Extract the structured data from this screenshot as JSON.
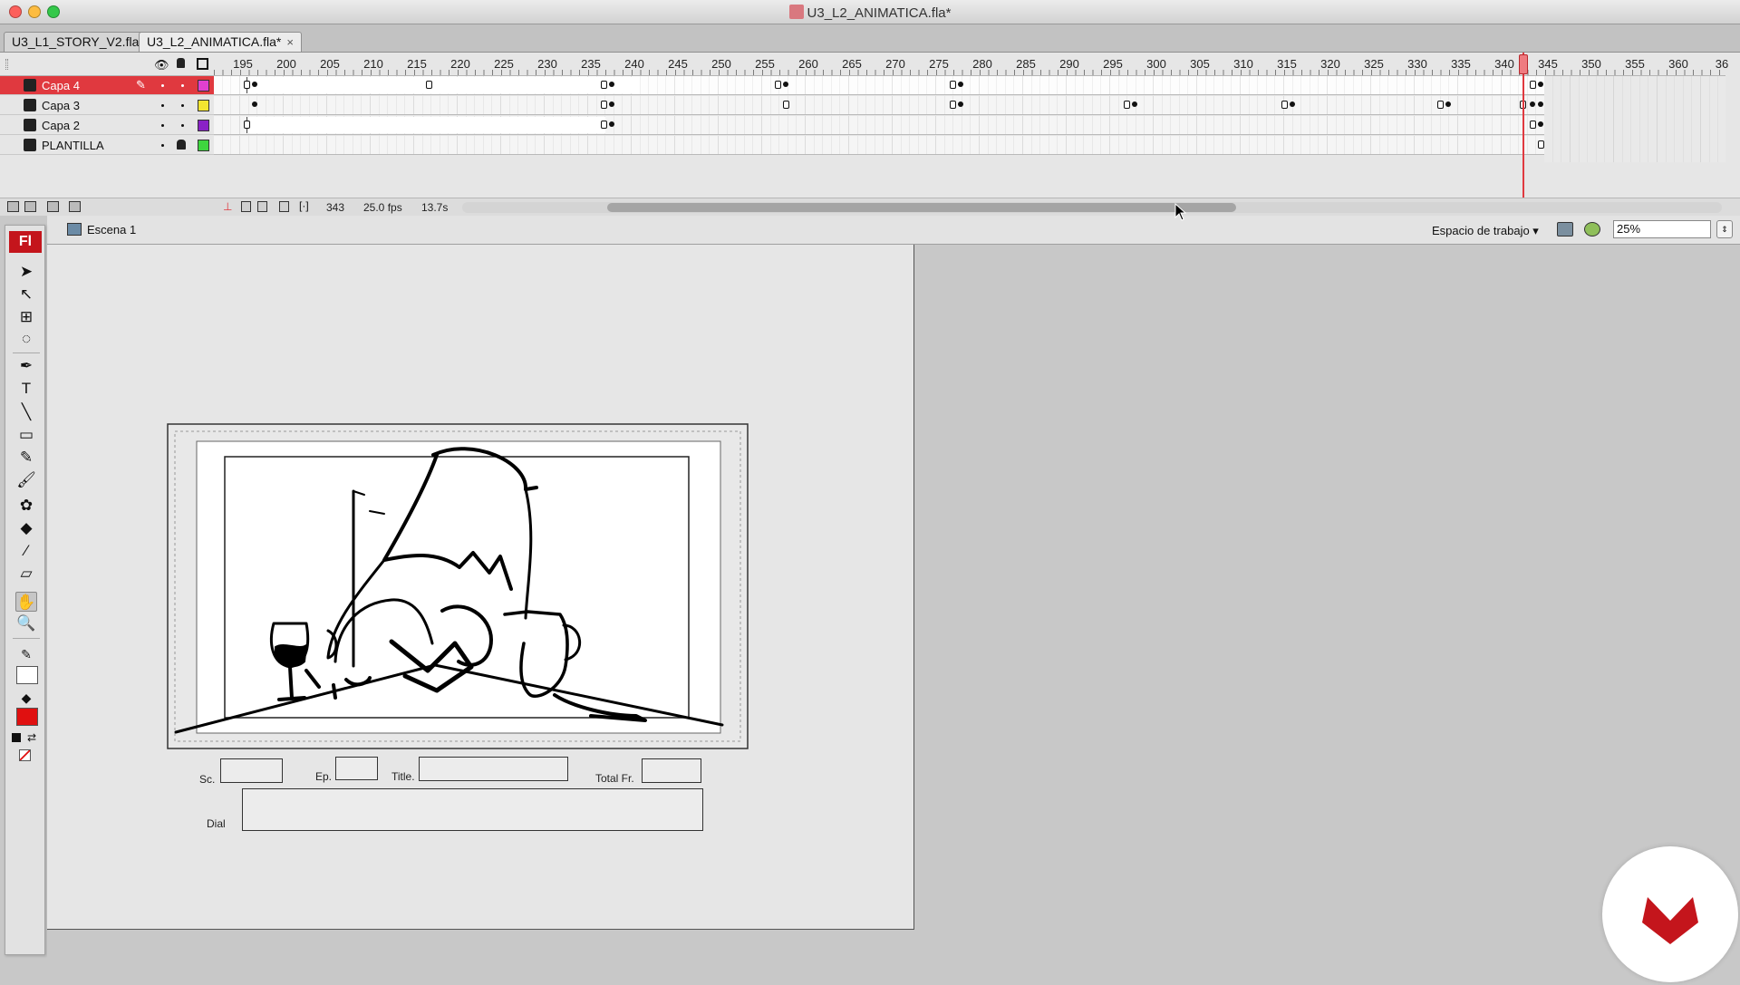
{
  "window": {
    "title": "U3_L2_ANIMATICA.fla*"
  },
  "tabs": [
    {
      "label": "U3_L1_STORY_V2.fla",
      "active": false
    },
    {
      "label": "U3_L2_ANIMATICA.fla*",
      "active": true,
      "close": "×"
    }
  ],
  "timeline": {
    "ruler_labels": [
      "195",
      "200",
      "205",
      "210",
      "215",
      "220",
      "225",
      "230",
      "235",
      "240",
      "245",
      "250",
      "255",
      "260",
      "265",
      "270",
      "275",
      "280",
      "285",
      "290",
      "295",
      "300",
      "305",
      "310",
      "315",
      "320",
      "325",
      "330",
      "335",
      "340",
      "345",
      "350",
      "355",
      "360",
      "36"
    ],
    "layers": [
      {
        "name": "Capa 4",
        "selected": true,
        "color": "#e040d0"
      },
      {
        "name": "Capa 3",
        "selected": false,
        "color": "#f3e530"
      },
      {
        "name": "Capa 2",
        "selected": false,
        "color": "#8a22c6"
      },
      {
        "name": "PLANTILLA",
        "selected": false,
        "color": "#3ed63e",
        "locked": true
      }
    ],
    "status": {
      "current_frame": "343",
      "fps": "25.0 fps",
      "elapsed": "13.7s"
    }
  },
  "editbar": {
    "scene": "Escena 1",
    "workspace": "Espacio de trabajo ▾",
    "zoom": "25%"
  },
  "toolbar": {
    "logo": "Fl",
    "tools": [
      "selection-tool",
      "subselection-tool",
      "free-transform-tool",
      "lasso-tool",
      "pen-tool",
      "text-tool",
      "line-tool",
      "rectangle-tool",
      "pencil-tool",
      "brush-tool",
      "deco-tool",
      "paint-bucket-tool",
      "eyedropper-tool",
      "eraser-tool",
      "hand-tool",
      "zoom-tool"
    ],
    "stroke_color": "#ffffff",
    "fill_color": "#e01010"
  },
  "stage": {
    "form": {
      "sc_label": "Sc.",
      "ep_label": "Ep.",
      "title_label": "Title.",
      "total_label": "Total Fr.",
      "dial_label": "Dial"
    }
  },
  "colors": {
    "accent": "#e0393f",
    "badge": "#c4151c"
  }
}
